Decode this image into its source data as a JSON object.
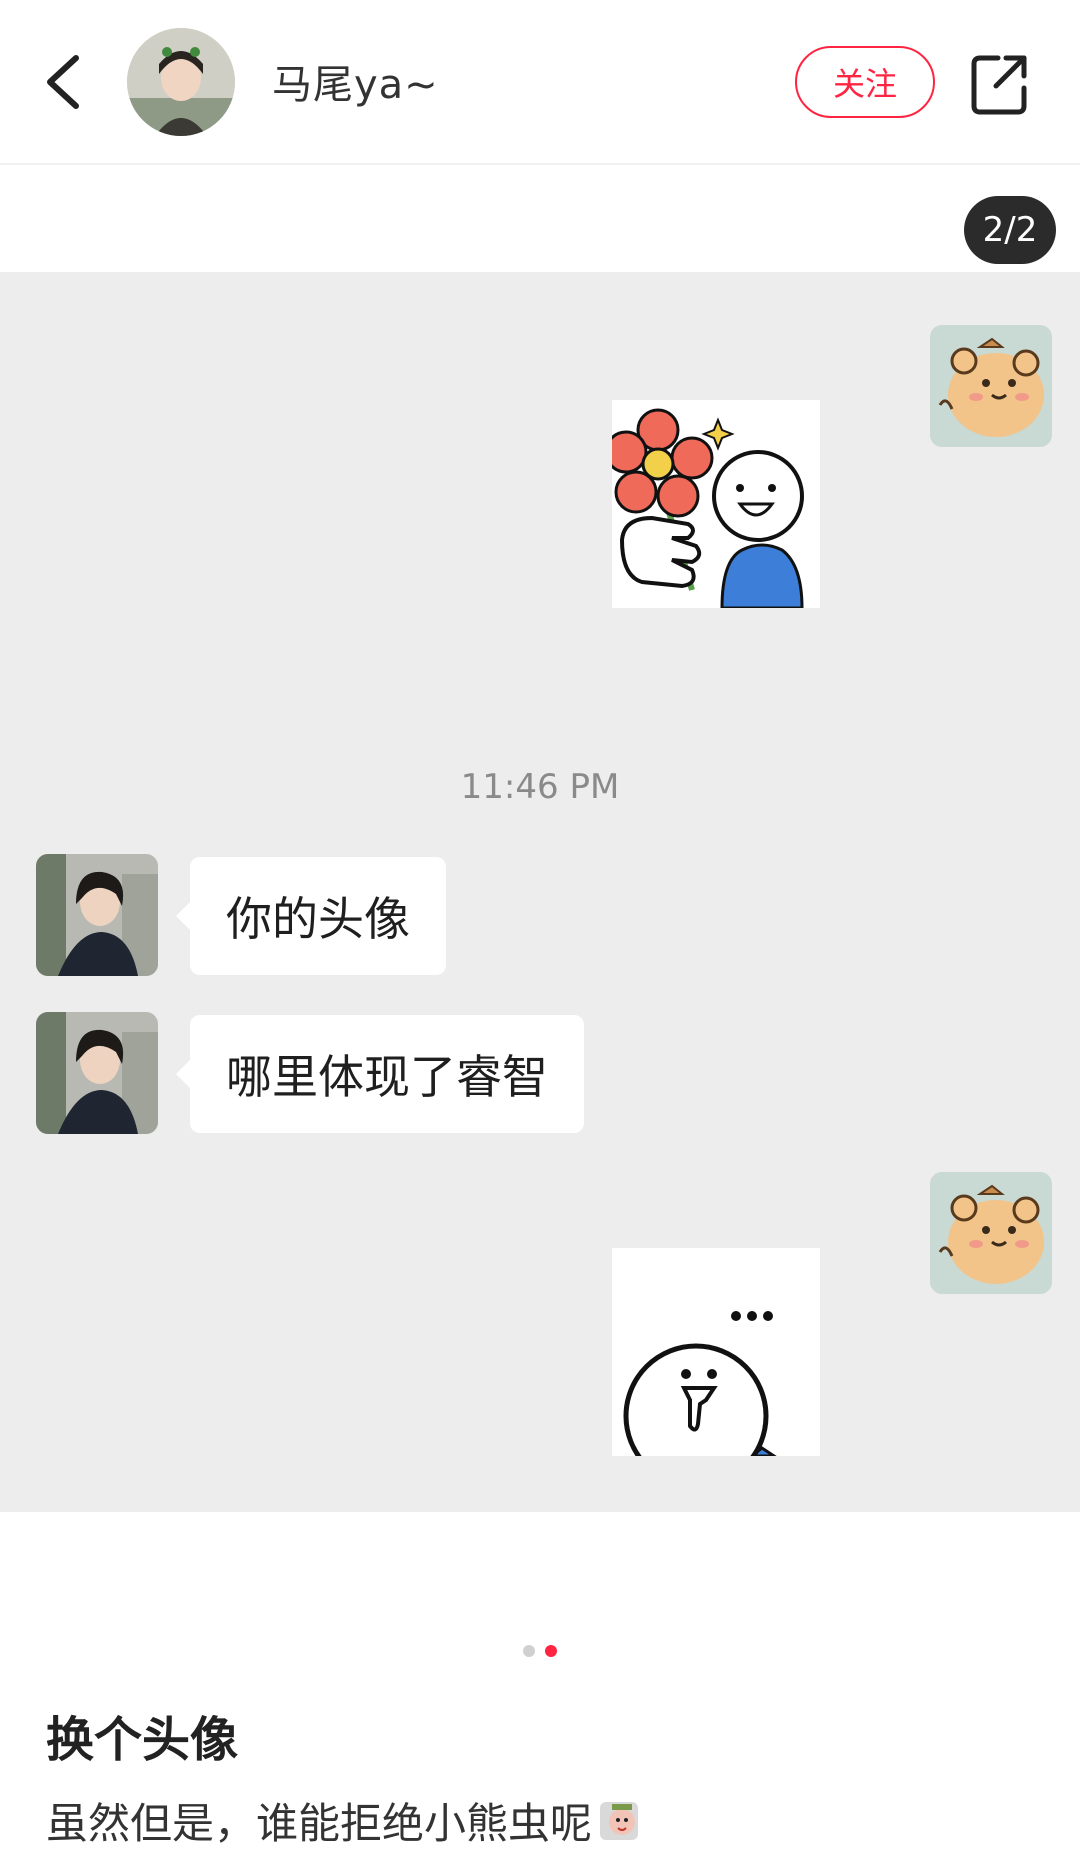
{
  "header": {
    "author_name": "马尾ya~",
    "follow_label": "关注",
    "icons": {
      "back": "chevron-left-icon",
      "share": "share-external-icon"
    }
  },
  "image": {
    "page_indicator": "2/2",
    "chat": {
      "timestamp": "11:46 PM",
      "messages": [
        {
          "sender": "other",
          "text": "你的头像"
        },
        {
          "sender": "other",
          "text": "哪里体现了睿智"
        }
      ]
    }
  },
  "carousel": {
    "count": 2,
    "active": 2
  },
  "post": {
    "title": "换个头像",
    "description": "虽然但是，谁能拒绝小熊虫呢"
  },
  "colors": {
    "accent": "#ff2442",
    "chat_bg": "#ededed",
    "bubble": "#ffffff"
  }
}
